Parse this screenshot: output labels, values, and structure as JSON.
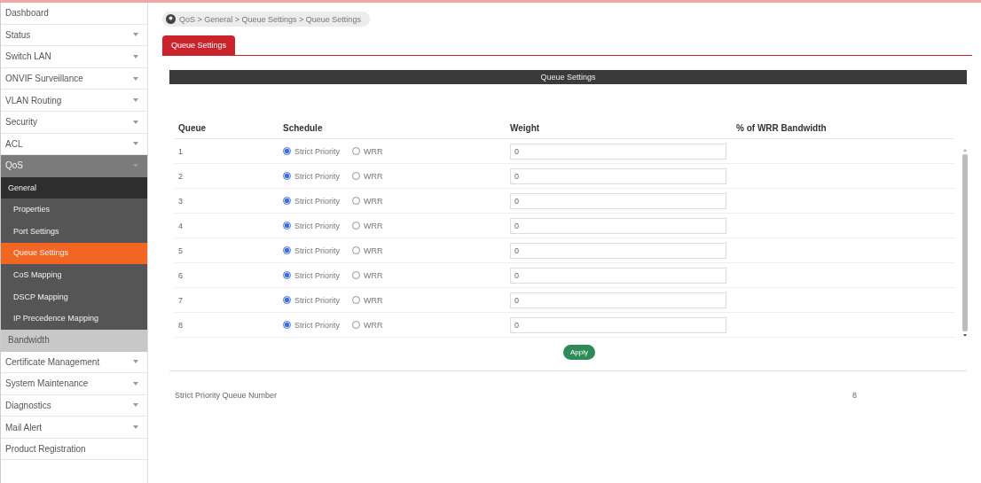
{
  "sidebar": {
    "items": [
      {
        "label": "Dashboard",
        "has_toggle": false,
        "expanded": false
      },
      {
        "label": "Status",
        "has_toggle": true,
        "expanded": false
      },
      {
        "label": "Switch LAN",
        "has_toggle": true,
        "expanded": false
      },
      {
        "label": "ONVIF Surveillance",
        "has_toggle": true,
        "expanded": false
      },
      {
        "label": "VLAN Routing",
        "has_toggle": true,
        "expanded": false
      },
      {
        "label": "Security",
        "has_toggle": true,
        "expanded": false
      },
      {
        "label": "ACL",
        "has_toggle": true,
        "expanded": false
      },
      {
        "label": "QoS",
        "has_toggle": true,
        "expanded": true,
        "children": [
          {
            "label": "General",
            "expanded": true,
            "children": [
              {
                "label": "Properties",
                "selected": false
              },
              {
                "label": "Port Settings",
                "selected": false
              },
              {
                "label": "Queue Settings",
                "selected": true
              },
              {
                "label": "CoS Mapping",
                "selected": false
              },
              {
                "label": "DSCP Mapping",
                "selected": false
              },
              {
                "label": "IP Precedence Mapping",
                "selected": false
              }
            ]
          },
          {
            "label": "Bandwidth",
            "expanded": false
          }
        ]
      },
      {
        "label": "Certificate Management",
        "has_toggle": true,
        "expanded": false
      },
      {
        "label": "System Maintenance",
        "has_toggle": true,
        "expanded": false
      },
      {
        "label": "Diagnostics",
        "has_toggle": true,
        "expanded": false
      },
      {
        "label": "Mail Alert",
        "has_toggle": true,
        "expanded": false
      },
      {
        "label": "Product Registration",
        "has_toggle": false,
        "expanded": false
      }
    ]
  },
  "breadcrumb": "QoS > General > Queue Settings > Queue Settings",
  "tabs": [
    {
      "label": "Queue Settings",
      "selected": true
    }
  ],
  "section_title": "Queue Settings",
  "table": {
    "columns": [
      "Queue",
      "Schedule",
      "Weight",
      "% of WRR Bandwidth"
    ],
    "rows": [
      {
        "queue": "1",
        "schedule": [
          {
            "label": "Strict Priority",
            "selected": true
          },
          {
            "label": "WRR",
            "selected": false
          }
        ],
        "weight": "0"
      },
      {
        "queue": "2",
        "schedule": [
          {
            "label": "Strict Priority",
            "selected": true
          },
          {
            "label": "WRR",
            "selected": false
          }
        ],
        "weight": "0"
      },
      {
        "queue": "3",
        "schedule": [
          {
            "label": "Strict Priority",
            "selected": true
          },
          {
            "label": "WRR",
            "selected": false
          }
        ],
        "weight": "0"
      },
      {
        "queue": "4",
        "schedule": [
          {
            "label": "Strict Priority",
            "selected": true
          },
          {
            "label": "WRR",
            "selected": false
          }
        ],
        "weight": "0"
      },
      {
        "queue": "5",
        "schedule": [
          {
            "label": "Strict Priority",
            "selected": true
          },
          {
            "label": "WRR",
            "selected": false
          }
        ],
        "weight": "0"
      },
      {
        "queue": "6",
        "schedule": [
          {
            "label": "Strict Priority",
            "selected": true
          },
          {
            "label": "WRR",
            "selected": false
          }
        ],
        "weight": "0"
      },
      {
        "queue": "7",
        "schedule": [
          {
            "label": "Strict Priority",
            "selected": true
          },
          {
            "label": "WRR",
            "selected": false
          }
        ],
        "weight": "0"
      },
      {
        "queue": "8",
        "schedule": [
          {
            "label": "Strict Priority",
            "selected": true
          },
          {
            "label": "WRR",
            "selected": false
          }
        ],
        "weight": "0"
      }
    ]
  },
  "apply_button": "Apply",
  "footer": {
    "label": "Strict Priority Queue Number",
    "value": "8"
  }
}
